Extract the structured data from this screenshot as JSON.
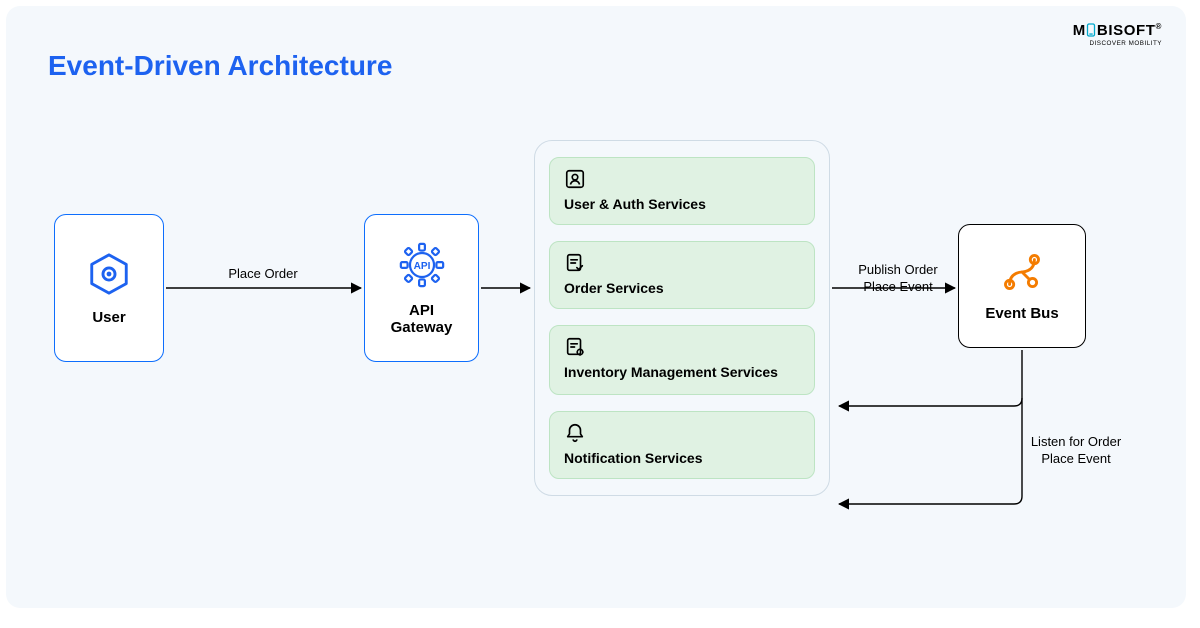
{
  "title": "Event-Driven Architecture",
  "brand": {
    "main_pre": "M",
    "main_post": "BISOFT",
    "registered": "®",
    "sub": "DISCOVER MOBILITY"
  },
  "nodes": {
    "user": {
      "label": "User"
    },
    "api": {
      "label_line1": "API",
      "label_line2": "Gateway",
      "badge": "API"
    },
    "eventbus": {
      "label": "Event Bus"
    }
  },
  "services": {
    "auth": {
      "label": "User & Auth Services"
    },
    "order": {
      "label": "Order Services"
    },
    "inventory": {
      "label": "Inventory Management Services"
    },
    "notif": {
      "label": "Notification Services"
    }
  },
  "edges": {
    "place_order": {
      "label": "Place Order"
    },
    "publish": {
      "label_line1": "Publish Order",
      "label_line2": "Place Event"
    },
    "listen": {
      "label_line1": "Listen for Order",
      "label_line2": "Place Event"
    }
  }
}
